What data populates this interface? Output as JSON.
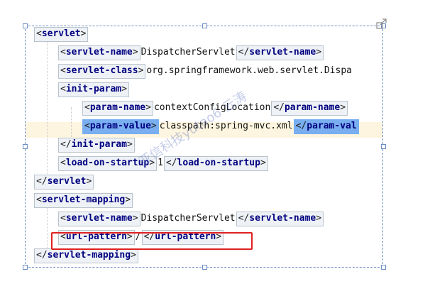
{
  "lines": [
    {
      "indent": 0,
      "parts": [
        {
          "t": "open",
          "v": "servlet"
        }
      ]
    },
    {
      "indent": 1,
      "parts": [
        {
          "t": "open",
          "v": "servlet-name"
        },
        {
          "t": "text",
          "v": "DispatcherServlet"
        },
        {
          "t": "close",
          "v": "servlet-name"
        }
      ]
    },
    {
      "indent": 1,
      "parts": [
        {
          "t": "open",
          "v": "servlet-class"
        },
        {
          "t": "text",
          "v": "org.springframework.web.servlet.Dispa"
        }
      ]
    },
    {
      "indent": 1,
      "parts": [
        {
          "t": "open",
          "v": "init-param"
        }
      ]
    },
    {
      "indent": 2,
      "parts": [
        {
          "t": "open",
          "v": "param-name"
        },
        {
          "t": "text",
          "v": "contextConfigLocation"
        },
        {
          "t": "close",
          "v": "param-name"
        }
      ]
    },
    {
      "indent": 2,
      "parts": [
        {
          "t": "open",
          "v": "param-value",
          "sel": true
        },
        {
          "t": "text",
          "v": "classpath:spring-mvc.xml"
        },
        {
          "t": "close",
          "v": "param-val",
          "sel": true
        }
      ]
    },
    {
      "indent": 1,
      "parts": [
        {
          "t": "close",
          "v": "init-param"
        }
      ]
    },
    {
      "indent": 1,
      "parts": [
        {
          "t": "open",
          "v": "load-on-startup"
        },
        {
          "t": "text",
          "v": "1"
        },
        {
          "t": "close",
          "v": "load-on-startup"
        }
      ]
    },
    {
      "indent": 0,
      "parts": [
        {
          "t": "close",
          "v": "servlet"
        }
      ]
    },
    {
      "indent": 0,
      "parts": [
        {
          "t": "open",
          "v": "servlet-mapping"
        }
      ]
    },
    {
      "indent": 1,
      "parts": [
        {
          "t": "open",
          "v": "servlet-name"
        },
        {
          "t": "text",
          "v": "DispatcherServlet"
        },
        {
          "t": "close",
          "v": "servlet-name"
        }
      ]
    },
    {
      "indent": 1,
      "parts": [
        {
          "t": "open",
          "v": "url-pattern"
        },
        {
          "t": "text",
          "v": "/"
        },
        {
          "t": "close",
          "v": "url-pattern"
        }
      ]
    },
    {
      "indent": 0,
      "parts": [
        {
          "t": "close",
          "v": "servlet-mapping"
        }
      ]
    }
  ],
  "watermark": "亚信科技yutao6 云涛",
  "icons": {
    "resize": "resize-handle-icon"
  },
  "colors": {
    "tag_name": "#000080",
    "selection": "#79aef0",
    "highlight_box": "#e02020",
    "current_line": "#fdf5df"
  }
}
